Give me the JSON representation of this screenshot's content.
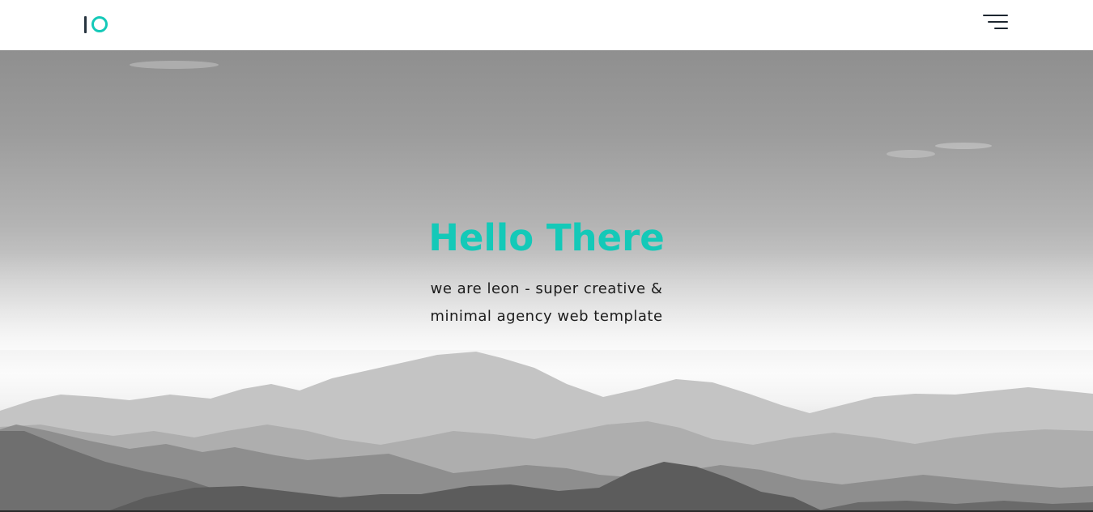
{
  "header": {
    "logo_icon": "logo-io-icon",
    "menu_icon": "hamburger-menu-icon"
  },
  "hero": {
    "title": "Hello There",
    "subtitle_line1": "we are leon - super creative &",
    "subtitle_line2": "minimal agency web template",
    "background_image": "grayscale-mountains-photo"
  },
  "colors": {
    "accent": "#14c9b8",
    "logo_dark": "#27343f",
    "menu_lines": "#1d2630",
    "subtitle_text": "#1c1c1c"
  }
}
